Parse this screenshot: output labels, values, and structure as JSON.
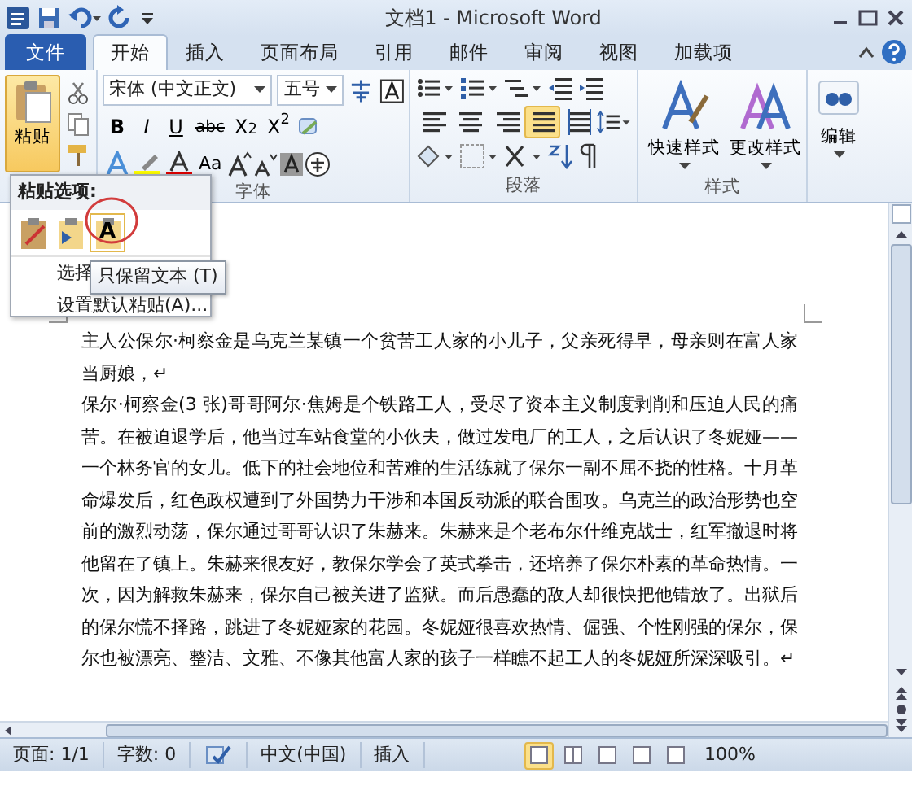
{
  "window": {
    "title": "文档1 - Microsoft Word"
  },
  "tabs": [
    {
      "label": "文件",
      "kind": "file",
      "selected": false
    },
    {
      "label": "开始",
      "kind": "tab",
      "selected": true
    },
    {
      "label": "插入",
      "kind": "tab",
      "selected": false
    },
    {
      "label": "页面布局",
      "kind": "tab",
      "selected": false
    },
    {
      "label": "引用",
      "kind": "tab",
      "selected": false
    },
    {
      "label": "邮件",
      "kind": "tab",
      "selected": false
    },
    {
      "label": "审阅",
      "kind": "tab",
      "selected": false
    },
    {
      "label": "视图",
      "kind": "tab",
      "selected": false
    },
    {
      "label": "加载项",
      "kind": "tab",
      "selected": false
    }
  ],
  "clipboard": {
    "paste_label": "粘贴"
  },
  "font": {
    "name": "宋体 (中文正文)",
    "size": "五号",
    "format_buttons": [
      "B",
      "I",
      "U",
      "abc",
      "X$_{2}$",
      "X$^{2}$"
    ],
    "case_button": "Aa",
    "group_label": "字体"
  },
  "paragraph": {
    "alignments": [
      {
        "selected": false
      },
      {
        "selected": false
      },
      {
        "selected": false
      },
      {
        "selected": true
      },
      {
        "selected": false
      }
    ],
    "group_label": "段落"
  },
  "styles": {
    "buttons": [
      "快速样式",
      "更改样式"
    ],
    "group_label": "样式"
  },
  "editing": {
    "label": "编辑"
  },
  "paste_menu": {
    "title": "粘贴选项:",
    "options": [
      {
        "selected": false
      },
      {
        "selected": false
      },
      {
        "selected": true,
        "label": "A"
      }
    ],
    "items": [
      "选择",
      "设置默认粘贴(A)..."
    ]
  },
  "tooltip": "只保留文本 (T)",
  "document": {
    "paragraphs": [
      "主人公保尔·柯察金是乌克兰某镇一个贫苦工人家的小儿子，父亲死得早，母亲则在富人家当厨娘，↵",
      "保尔·柯察金(3 张)哥哥阿尔·焦姆是个铁路工人，受尽了资本主义制度剥削和压迫人民的痛苦。在被迫退学后，他当过车站食堂的小伙夫，做过发电厂的工人，之后认识了冬妮娅——一个林务官的女儿。低下的社会地位和苦难的生活练就了保尔一副不屈不挠的性格。十月革命爆发后，红色政权遭到了外国势力干涉和本国反动派的联合围攻。乌克兰的政治形势也空前的激烈动荡，保尔通过哥哥认识了朱赫来。朱赫来是个老布尔什维克战士，红军撤退时将他留在了镇上。朱赫来很友好，教保尔学会了英式拳击，还培养了保尔朴素的革命热情。一次，因为解救朱赫来，保尔自己被关进了监狱。而后愚蠢的敌人却很快把他错放了。出狱后的保尔慌不择路，跳进了冬妮娅家的花园。冬妮娅很喜欢热情、倔强、个性刚强的保尔，保尔也被漂亮、整洁、文雅、不像其他富人家的孩子一样瞧不起工人的冬妮娅所深深吸引。↵"
    ]
  },
  "status_bar": {
    "page": "页面: 1/1",
    "words": "字数: 0",
    "language": "中文(中国)",
    "mode": "插入",
    "zoom": "100%",
    "views": [
      {
        "selected": true
      },
      {
        "selected": false
      },
      {
        "selected": false
      },
      {
        "selected": false
      },
      {
        "selected": false
      }
    ]
  }
}
